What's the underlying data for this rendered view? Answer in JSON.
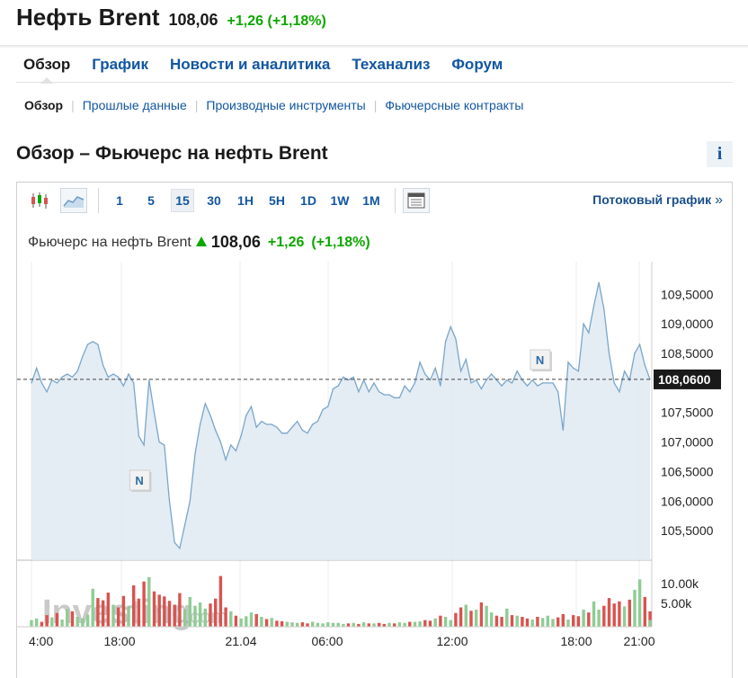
{
  "header": {
    "title": "Нефть Brent",
    "price": "108,06",
    "change": "+1,26",
    "change_pct": "(+1,18%)"
  },
  "tabs": [
    {
      "label": "Обзор",
      "active": true
    },
    {
      "label": "График",
      "active": false
    },
    {
      "label": "Новости и аналитика",
      "active": false
    },
    {
      "label": "Теханализ",
      "active": false
    },
    {
      "label": "Форум",
      "active": false
    }
  ],
  "subtabs": [
    {
      "label": "Обзор",
      "active": true
    },
    {
      "label": "Прошлые данные",
      "active": false
    },
    {
      "label": "Производные инструменты",
      "active": false
    },
    {
      "label": "Фьючерсные контракты",
      "active": false
    }
  ],
  "section_title": "Обзор – Фьючерс на нефть Brent",
  "info_button": "i",
  "toolbar": {
    "icons": [
      "candlestick-chart-icon",
      "area-chart-icon"
    ],
    "timeframes": [
      {
        "label": "1",
        "active": false
      },
      {
        "label": "5",
        "active": false
      },
      {
        "label": "15",
        "active": true
      },
      {
        "label": "30",
        "active": false
      },
      {
        "label": "1H",
        "active": false
      },
      {
        "label": "5H",
        "active": false
      },
      {
        "label": "1D",
        "active": false
      },
      {
        "label": "1W",
        "active": false
      },
      {
        "label": "1M",
        "active": false
      }
    ],
    "extra_icon": "layout-table-icon",
    "streaming_label": "Потоковый график",
    "streaming_chevron": "»"
  },
  "quote": {
    "name": "Фьючерс на нефть Brent",
    "last": "108,06",
    "change": "+1,26",
    "change_pct": "(+1,18%)"
  },
  "watermark": {
    "text": "Investing",
    "suffix": ".com"
  },
  "colors": {
    "up": "#0ea600",
    "link": "#1256a0",
    "area_fill": "#dfe9f2",
    "line": "#7aa6c9",
    "vol_up": "#8fcc95",
    "vol_down": "#d9534f"
  },
  "chart_data": {
    "type": "area",
    "ylim": [
      105.0,
      109.9
    ],
    "y_ticks": [
      "109,5000",
      "109,0000",
      "108,5000",
      "107,5000",
      "107,0000",
      "106,5000",
      "106,0000",
      "105,5000"
    ],
    "last_price_label": "108,0600",
    "last_price_value": 108.06,
    "x_tick_labels": [
      "4:00",
      "18:00",
      "21.04",
      "06:00",
      "12:00",
      "18:00",
      "21:00"
    ],
    "news_markers": [
      {
        "label": "N",
        "index": 21
      },
      {
        "label": "N",
        "index": 99
      }
    ],
    "values": [
      108.0,
      108.25,
      108.0,
      107.85,
      108.05,
      108.0,
      108.1,
      108.15,
      108.1,
      108.2,
      108.45,
      108.65,
      108.7,
      108.65,
      108.3,
      108.1,
      108.15,
      108.1,
      107.95,
      108.15,
      108.0,
      107.1,
      106.95,
      108.05,
      107.5,
      107.0,
      106.95,
      106.0,
      105.3,
      105.2,
      105.6,
      106.0,
      106.8,
      107.3,
      107.65,
      107.45,
      107.2,
      107.0,
      106.7,
      106.95,
      106.85,
      107.1,
      107.45,
      107.6,
      107.25,
      107.35,
      107.3,
      107.3,
      107.25,
      107.15,
      107.15,
      107.25,
      107.35,
      107.2,
      107.15,
      107.3,
      107.35,
      107.55,
      107.6,
      107.9,
      107.95,
      108.1,
      108.05,
      108.1,
      107.85,
      108.05,
      107.85,
      108.0,
      107.85,
      107.8,
      107.8,
      107.75,
      107.75,
      107.95,
      107.85,
      108.0,
      108.35,
      108.15,
      108.05,
      108.25,
      107.95,
      108.7,
      108.95,
      108.75,
      108.2,
      108.4,
      108.0,
      108.05,
      107.9,
      108.05,
      108.15,
      108.05,
      107.95,
      108.05,
      108.0,
      108.2,
      108.05,
      107.95,
      108.05,
      107.95,
      108.0,
      108.0,
      108.0,
      107.85,
      107.2,
      108.35,
      108.25,
      108.2,
      109.0,
      108.85,
      109.3,
      109.7,
      109.25,
      108.5,
      108.0,
      107.85,
      108.2,
      108.05,
      108.5,
      108.65,
      108.3,
      108.06
    ],
    "volume_ticks": [
      "10.00k",
      "5.00k"
    ],
    "volume": [
      1200,
      1500,
      900,
      2100,
      1700,
      2500,
      1300,
      3200,
      2800,
      1800,
      1500,
      2200,
      6900,
      5200,
      4800,
      6200,
      4000,
      3500,
      5600,
      3800,
      7500,
      5100,
      8200,
      9000,
      6400,
      5800,
      5500,
      4700,
      4000,
      6100,
      3200,
      5400,
      3800,
      4400,
      3300,
      4200,
      5100,
      9200,
      3500,
      2800,
      2000,
      1500,
      1900,
      2600,
      2300,
      1800,
      1400,
      1600,
      1100,
      1000,
      900,
      800,
      700,
      800,
      600,
      900,
      700,
      600,
      800,
      700,
      700,
      500,
      600,
      700,
      500,
      800,
      600,
      600,
      700,
      500,
      700,
      600,
      800,
      700,
      900,
      900,
      1000,
      1200,
      1100,
      1500,
      2000,
      1800,
      1200,
      2500,
      3500,
      4000,
      2900,
      3100,
      4400,
      3800,
      2600,
      2000,
      1800,
      3300,
      2100,
      2000,
      1800,
      1500,
      1300,
      1800,
      1600,
      2000,
      1400,
      1700,
      2300,
      1300,
      2100,
      1900,
      3100,
      2600,
      4600,
      3100,
      3800,
      5200,
      4200,
      4600,
      3700,
      4900,
      6700,
      8600,
      5400,
      2800,
      1200
    ],
    "volume_ylim": [
      0,
      15000
    ]
  }
}
